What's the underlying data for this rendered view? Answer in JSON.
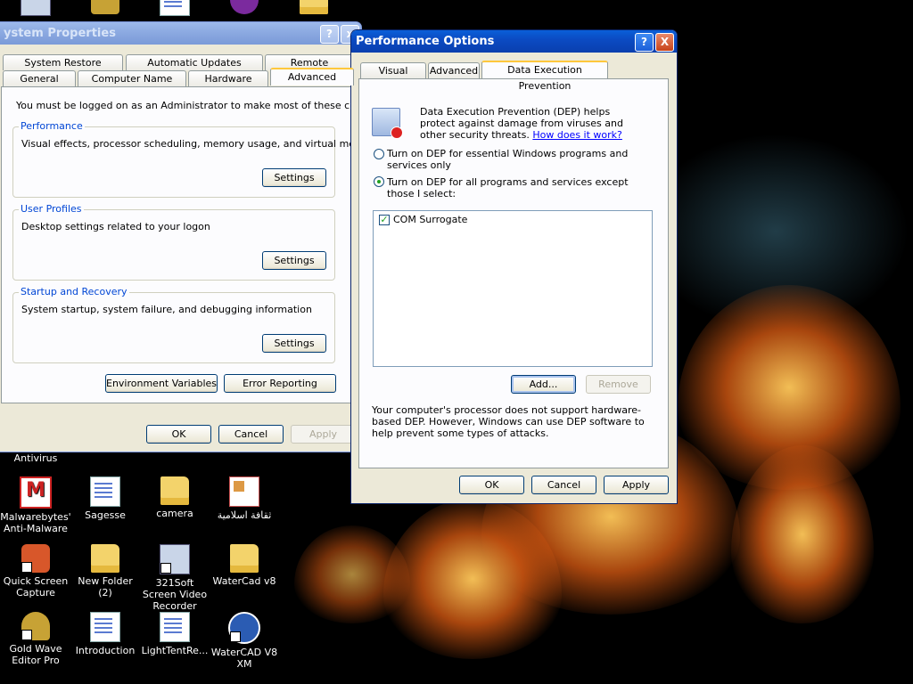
{
  "desktop": {
    "icons": [
      {
        "label": "Antivirus"
      },
      {
        "label": "Malwarebytes' Anti-Malware"
      },
      {
        "label": "Sagesse"
      },
      {
        "label": "camera"
      },
      {
        "label": "ثقافة اسلامية"
      },
      {
        "label": "Quick Screen Capture"
      },
      {
        "label": "New Folder (2)"
      },
      {
        "label": "321Soft Screen Video Recorder"
      },
      {
        "label": "WaterCad v8"
      },
      {
        "label": "Gold Wave Editor Pro"
      },
      {
        "label": "Introduction"
      },
      {
        "label": "LightTentRe..."
      },
      {
        "label": "WaterCAD V8 XM"
      }
    ]
  },
  "system_properties": {
    "title": "ystem Properties",
    "help": "?",
    "close": "x",
    "tabs_row1": [
      "System Restore",
      "Automatic Updates",
      "Remote"
    ],
    "tabs_row2": [
      "General",
      "Computer Name",
      "Hardware",
      "Advanced"
    ],
    "admin_note": "You must be logged on as an Administrator to make most of these changes.",
    "performance": {
      "title": "Performance",
      "desc": "Visual effects, processor scheduling, memory usage, and virtual memory",
      "button": "Settings"
    },
    "user_profiles": {
      "title": "User Profiles",
      "desc": "Desktop settings related to your logon",
      "button": "Settings"
    },
    "startup": {
      "title": "Startup and Recovery",
      "desc": "System startup, system failure, and debugging information",
      "button": "Settings"
    },
    "env_button": "Environment Variables",
    "error_button": "Error Reporting",
    "ok": "OK",
    "cancel": "Cancel",
    "apply": "Apply"
  },
  "performance_options": {
    "title": "Performance Options",
    "help": "?",
    "close": "X",
    "tabs": [
      "Visual Effects",
      "Advanced",
      "Data Execution Prevention"
    ],
    "dep_text": "Data Execution Prevention (DEP) helps protect against damage from viruses and other security threats.",
    "dep_link": "How does it work?",
    "radio1": "Turn on DEP for essential Windows programs and services only",
    "radio2": "Turn on DEP for all programs and services except those I select:",
    "list_items": [
      {
        "label": "COM Surrogate",
        "checked": true
      }
    ],
    "add": "Add...",
    "remove": "Remove",
    "processor_note": "Your computer's processor does not support hardware-based DEP. However, Windows can use DEP software to help prevent some types of attacks.",
    "ok": "OK",
    "cancel": "Cancel",
    "apply": "Apply"
  }
}
